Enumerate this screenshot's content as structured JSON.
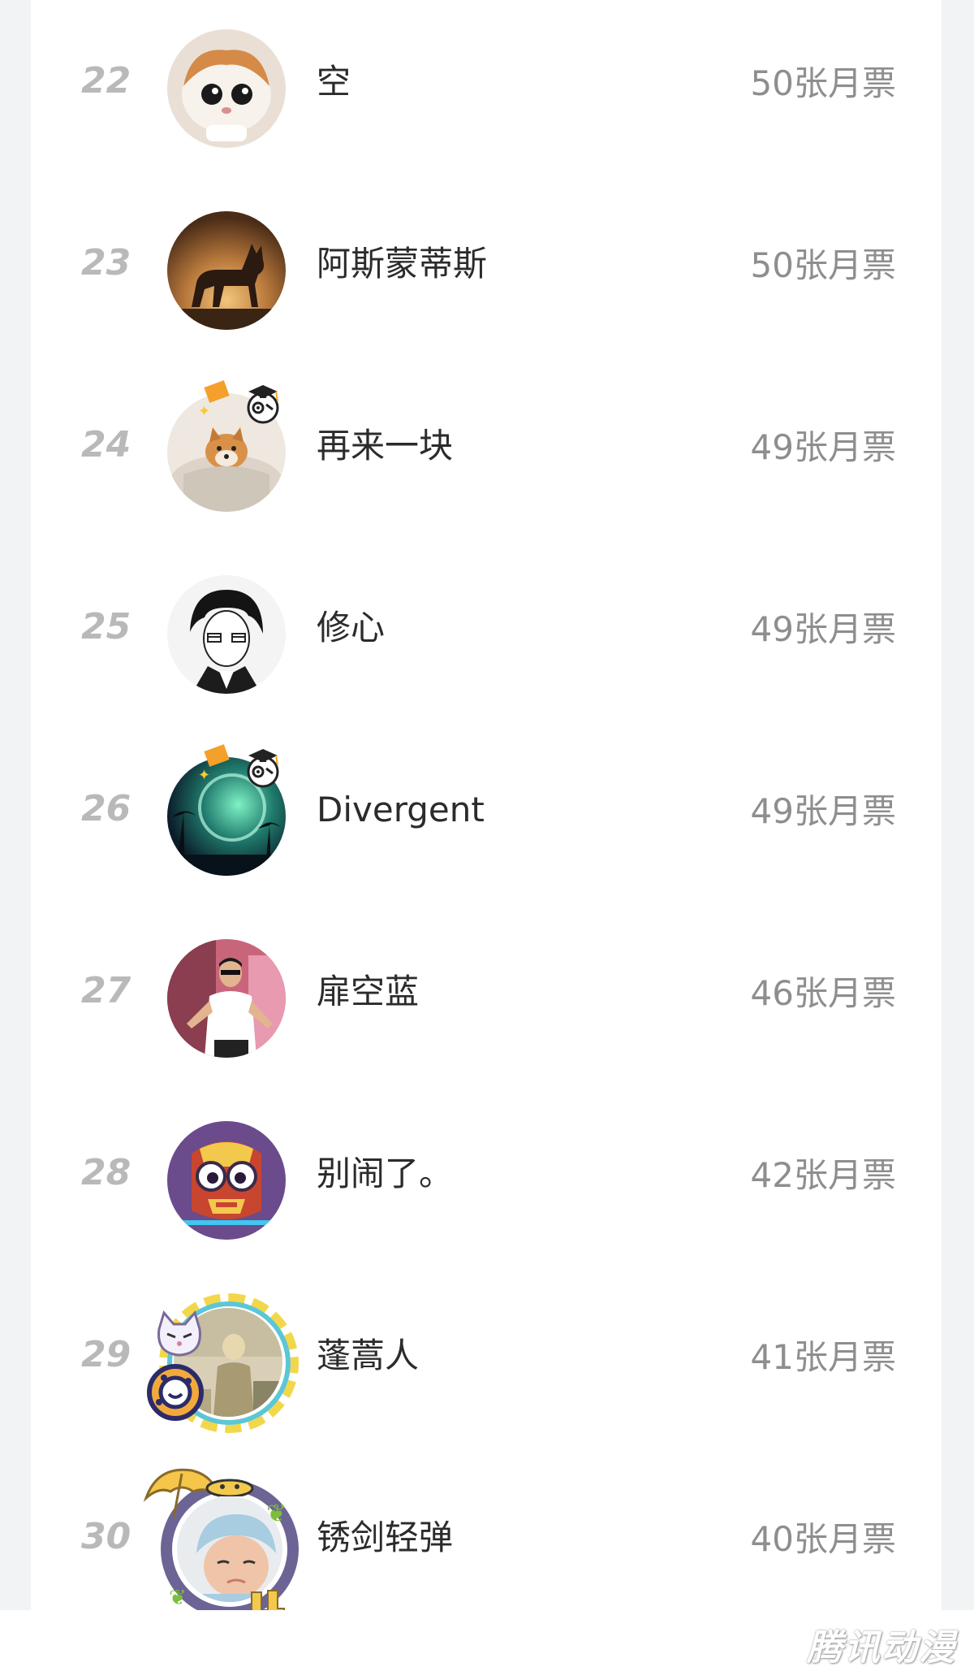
{
  "leaderboard": {
    "rows": [
      {
        "rank": "22",
        "name": "空",
        "votes": "50张月票",
        "avatar": "cat-avatar"
      },
      {
        "rank": "23",
        "name": "阿斯蒙蒂斯",
        "votes": "50张月票",
        "avatar": "dog-silhouette-avatar"
      },
      {
        "rank": "24",
        "name": "再来一块",
        "votes": "49张月票",
        "avatar": "shiba-avatar",
        "badge": "scholar-badge"
      },
      {
        "rank": "25",
        "name": "修心",
        "votes": "49张月票",
        "avatar": "manga-boy-avatar"
      },
      {
        "rank": "26",
        "name": "Divergent",
        "votes": "49张月票",
        "avatar": "aurora-avatar",
        "badge": "scholar-badge"
      },
      {
        "rank": "27",
        "name": "扉空蓝",
        "votes": "46张月票",
        "avatar": "man-photo-avatar"
      },
      {
        "rank": "28",
        "name": "别闹了。",
        "votes": "42张月票",
        "avatar": "robot-owl-avatar"
      },
      {
        "rank": "29",
        "name": "蓬蒿人",
        "votes": "41张月票",
        "avatar": "painting-avatar",
        "frame": "striped-ring-frame"
      },
      {
        "rank": "30",
        "name": "锈剑轻弹",
        "votes": "40张月票",
        "avatar": "baby-avatar",
        "frame": "umbrella-frame"
      }
    ]
  },
  "watermark": "腾讯动漫"
}
